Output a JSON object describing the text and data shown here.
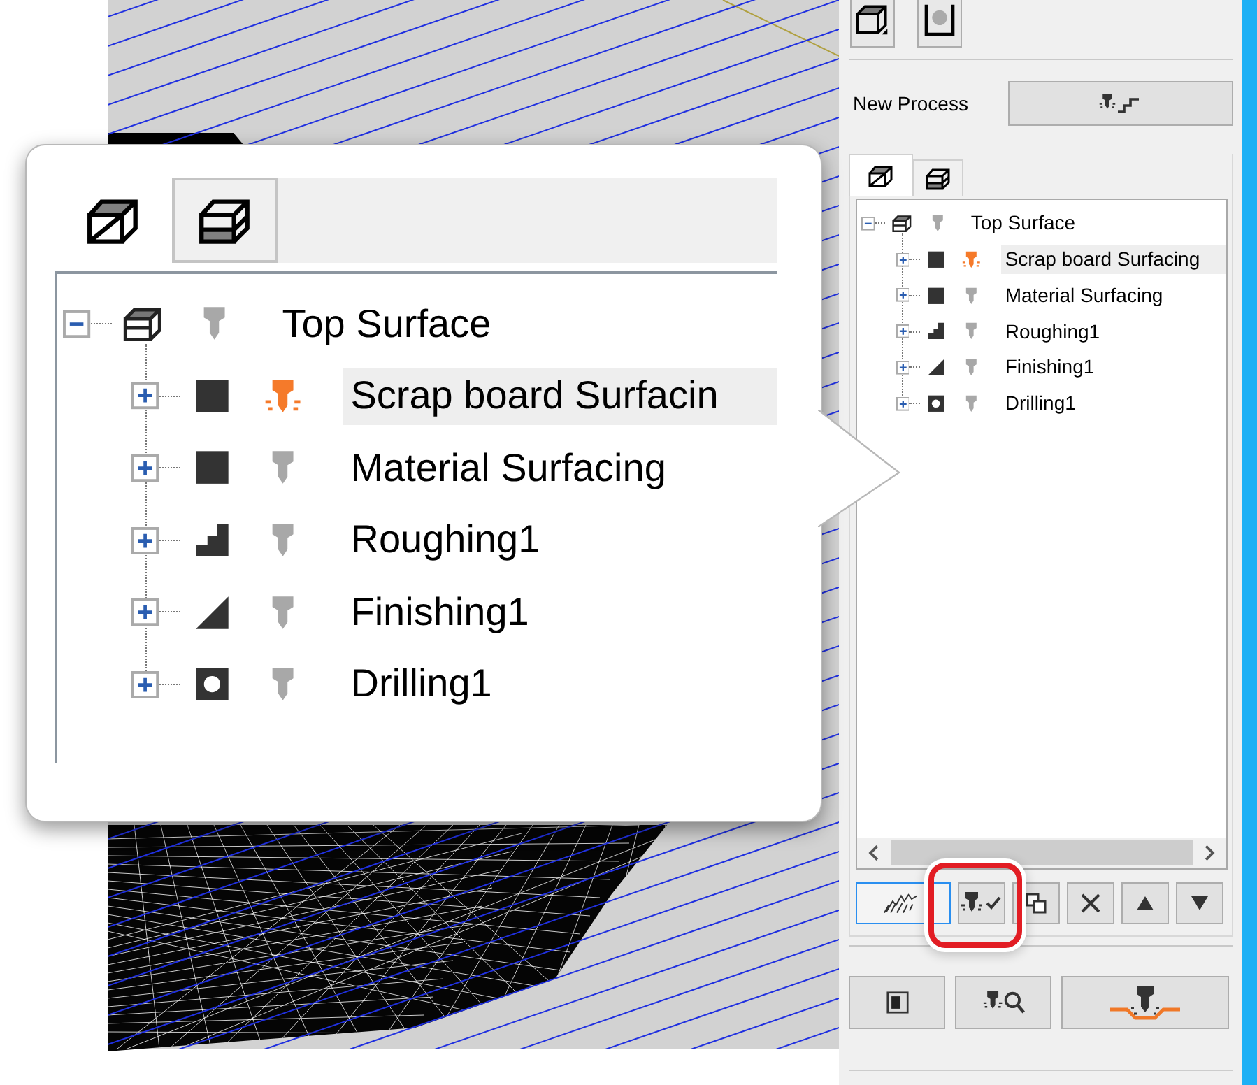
{
  "panel": {
    "new_process": {
      "label": "New Process"
    },
    "tabs": [
      {
        "kind": "top",
        "selected": true
      },
      {
        "kind": "bottom",
        "selected": false
      }
    ],
    "tree": {
      "label": "Top Surface",
      "kind": "setup",
      "expanded": true,
      "tool_active": false,
      "selected": false,
      "children": [
        {
          "label": "Scrap board Surfacing",
          "kind": "surfacing",
          "expanded": false,
          "tool_active": true,
          "selected": true
        },
        {
          "label": "Material Surfacing",
          "kind": "surfacing",
          "expanded": false,
          "tool_active": false,
          "selected": false
        },
        {
          "label": "Roughing1",
          "kind": "roughing",
          "expanded": false,
          "tool_active": false,
          "selected": false
        },
        {
          "label": "Finishing1",
          "kind": "finishing",
          "expanded": false,
          "tool_active": false,
          "selected": false
        },
        {
          "label": "Drilling1",
          "kind": "drilling",
          "expanded": false,
          "tool_active": false,
          "selected": false
        }
      ]
    },
    "toolbar": [
      {
        "kind": "calculate",
        "focused": true,
        "circled": false
      },
      {
        "kind": "check",
        "focused": false,
        "circled": true
      },
      {
        "kind": "copy",
        "focused": false,
        "circled": false
      },
      {
        "kind": "delete",
        "focused": false,
        "circled": false
      },
      {
        "kind": "move_up",
        "focused": false,
        "circled": false
      },
      {
        "kind": "move_down",
        "focused": false,
        "circled": false
      }
    ],
    "bottom_buttons": [
      {
        "kind": "simulate"
      },
      {
        "kind": "inspect"
      },
      {
        "kind": "machine"
      }
    ]
  },
  "callout": {
    "tabs": [
      {
        "kind": "top",
        "selected": true
      },
      {
        "kind": "bottom",
        "selected": false
      }
    ],
    "tree": {
      "label": "Top Surface",
      "kind": "setup",
      "expanded": true,
      "tool_active": false,
      "selected": false,
      "children": [
        {
          "label": "Scrap board Surfacin",
          "kind": "surfacing",
          "expanded": false,
          "tool_active": true,
          "selected": true
        },
        {
          "label": "Material Surfacing",
          "kind": "surfacing",
          "expanded": false,
          "tool_active": false,
          "selected": false
        },
        {
          "label": "Roughing1",
          "kind": "roughing",
          "expanded": false,
          "tool_active": false,
          "selected": false
        },
        {
          "label": "Finishing1",
          "kind": "finishing",
          "expanded": false,
          "tool_active": false,
          "selected": false
        },
        {
          "label": "Drilling1",
          "kind": "drilling",
          "expanded": false,
          "tool_active": false,
          "selected": false
        }
      ]
    }
  }
}
